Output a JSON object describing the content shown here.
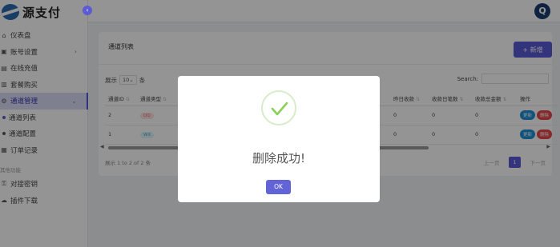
{
  "app": {
    "logo_text": "源支付",
    "collapse_icon": "chevron-left-icon"
  },
  "sidebar": {
    "items": [
      {
        "label": "仪表盘",
        "icon": "home-icon"
      },
      {
        "label": "账号设置",
        "icon": "user-icon",
        "chevron": "›"
      },
      {
        "label": "在线充值",
        "icon": "wallet-icon"
      },
      {
        "label": "套餐购买",
        "icon": "cart-icon"
      },
      {
        "label": "通道管理",
        "icon": "gear-icon",
        "chevron": "⌄"
      },
      {
        "label": "通道列表"
      },
      {
        "label": "通道配置"
      },
      {
        "label": "订单记录",
        "icon": "document-icon"
      }
    ],
    "section": "其他功能",
    "extra": [
      {
        "label": "对接密钥",
        "icon": "key-icon"
      },
      {
        "label": "插件下载",
        "icon": "cloud-download-icon"
      }
    ]
  },
  "topbar": {
    "avatar_letter": "Q"
  },
  "card": {
    "title": "通道列表",
    "add_label": "+ 新增",
    "show_prefix": "展示",
    "show_value": "10⌄",
    "show_suffix": "条",
    "search_label": "Search:",
    "columns": [
      "通道ID",
      "通道类型",
      "",
      "",
      "",
      "",
      "",
      "昨日收款",
      "收款日笔数",
      "收款总金额",
      "操作"
    ],
    "rows": [
      {
        "id": "2",
        "type": "QQ",
        "c3": "0",
        "c4": "0",
        "c5": "0"
      },
      {
        "id": "1",
        "type": "WX",
        "c3": "0",
        "c4": "0",
        "c5": "0"
      }
    ],
    "edit_label": "更新",
    "delete_label": "删除",
    "info": "展示 1 to 2 of 2 条",
    "pager": {
      "prev": "上一页",
      "current": "1",
      "next": "下一页"
    }
  },
  "modal": {
    "title": "删除成功!",
    "ok_label": "OK"
  }
}
